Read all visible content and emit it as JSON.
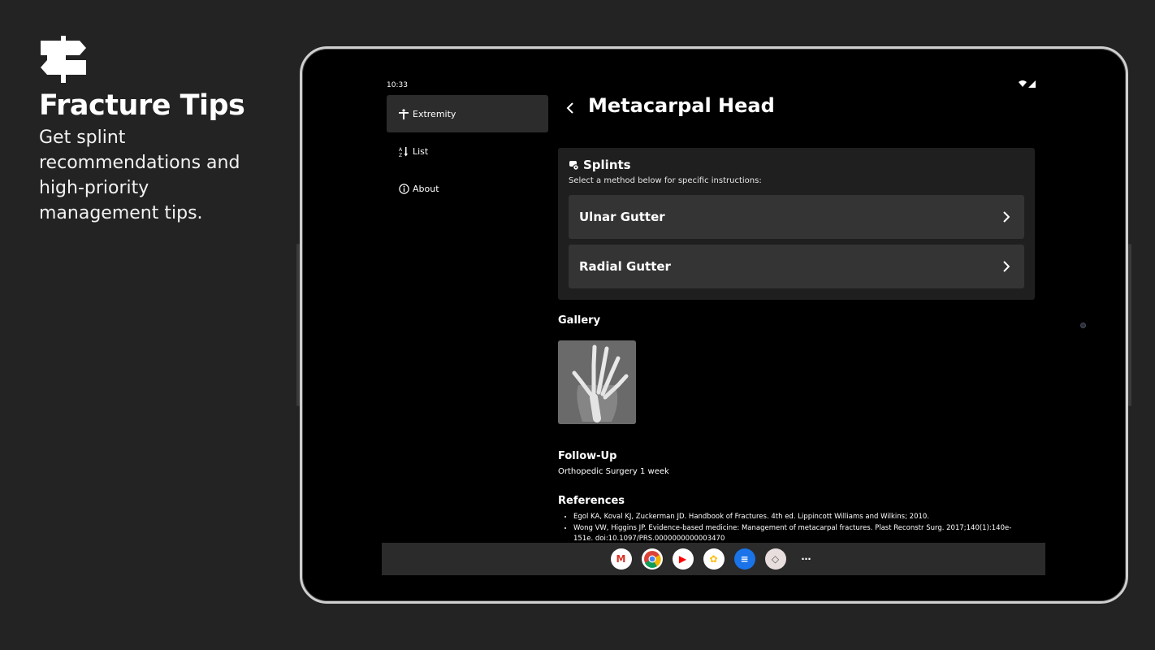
{
  "promo": {
    "title": "Fracture Tips",
    "subtitle": "Get splint recommendations and high-priority management tips."
  },
  "status": {
    "time": "10:33"
  },
  "nav": {
    "items": [
      {
        "label": "Extremity",
        "icon": "human-figure-icon"
      },
      {
        "label": "List",
        "icon": "sort-list-icon"
      },
      {
        "label": "About",
        "icon": "info-icon"
      }
    ]
  },
  "main": {
    "title": "Metacarpal Head",
    "splints": {
      "title": "Splints",
      "subtitle": "Select a method below for specific instructions:",
      "methods": [
        "Ulnar Gutter",
        "Radial Gutter"
      ]
    },
    "gallery_heading": "Gallery",
    "followup_heading": "Follow-Up",
    "followup_text": "Orthopedic Surgery 1 week",
    "references_heading": "References",
    "references": [
      "Egol KA, Koval KJ, Zuckerman JD. Handbook of Fractures. 4th ed. Lippincott Williams and Wilkins; 2010.",
      "Wong VW, Higgins JP. Evidence-based medicine: Management of metacarpal fractures. Plast Reconstr Surg. 2017;140(1):140e-151e. doi:10.1097/PRS.0000000000003470"
    ]
  },
  "dock": {
    "apps": [
      {
        "name": "gmail-icon",
        "glyph": "M",
        "bg": "#ffffff",
        "fg": "#d93025"
      },
      {
        "name": "chrome-icon",
        "glyph": "",
        "bg": "#ffffff",
        "fg": "#4285f4"
      },
      {
        "name": "youtube-icon",
        "glyph": "▶",
        "bg": "#ffffff",
        "fg": "#ff0000"
      },
      {
        "name": "photos-icon",
        "glyph": "✿",
        "bg": "#ffffff",
        "fg": "#fbbc04"
      },
      {
        "name": "messages-icon",
        "glyph": "≡",
        "bg": "#1a73e8",
        "fg": "#ffffff"
      },
      {
        "name": "fracture-tips-app-icon",
        "glyph": "◇",
        "bg": "#e9dede",
        "fg": "#555555"
      },
      {
        "name": "app-drawer-icon",
        "glyph": "⋯",
        "bg": "#2b2b2b",
        "fg": "#ffffff"
      }
    ]
  }
}
